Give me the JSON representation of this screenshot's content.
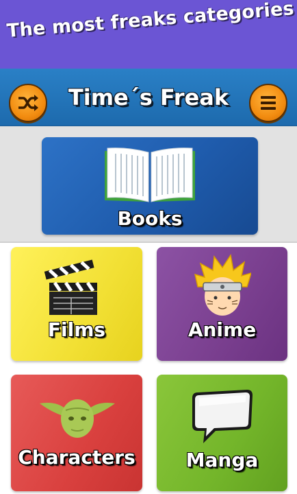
{
  "banner": {
    "text": "The most freaks categories"
  },
  "header": {
    "title": "Time´s Freak"
  },
  "toolbar": {
    "shuffle_icon": "shuffle-icon",
    "menu_icon": "hamburger-menu-icon"
  },
  "categories": [
    {
      "label": "Books",
      "icon": "open-book-icon",
      "color": "#1f5cad"
    },
    {
      "label": "Films",
      "icon": "clapperboard-icon",
      "color": "#f2e034"
    },
    {
      "label": "Anime",
      "icon": "ninja-head-icon",
      "color": "#7a3f8f"
    },
    {
      "label": "Characters",
      "icon": "yoda-head-icon",
      "color": "#d9403e"
    },
    {
      "label": "Manga",
      "icon": "speech-bubble-icon",
      "color": "#73b52a"
    }
  ],
  "colors": {
    "banner": "#6B55D4",
    "appbar": "#2a80c6",
    "button": "#f28c10"
  }
}
